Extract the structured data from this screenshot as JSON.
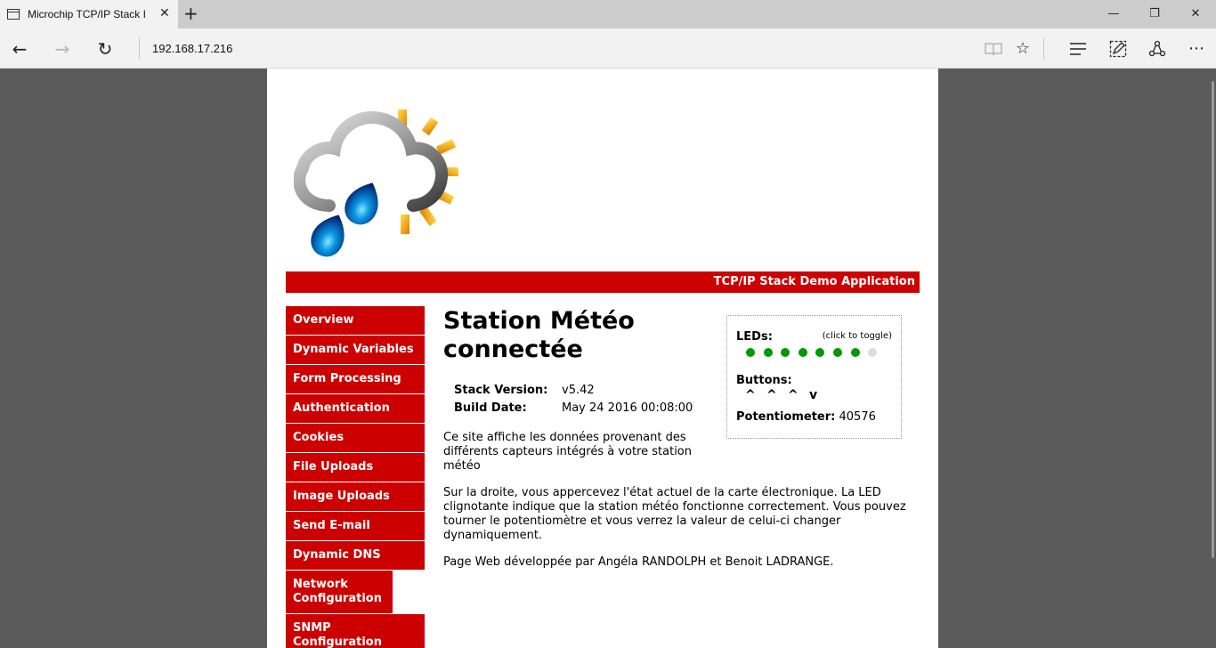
{
  "browser": {
    "tab_title": "Microchip TCP/IP Stack I",
    "tab_close": "✕",
    "new_tab": "+",
    "url": "192.168.17.216",
    "window_controls": {
      "minimize": "—",
      "restore": "❐",
      "close": "✕"
    },
    "nav": {
      "back": "←",
      "forward": "→",
      "refresh": "↻"
    },
    "tools": {
      "reading": "📖",
      "favorite": "☆",
      "hub": "☰",
      "note": "✎",
      "share": "⇪",
      "more": "⋯"
    }
  },
  "page": {
    "banner": "TCP/IP Stack Demo Application",
    "menu": [
      {
        "label": "Overview"
      },
      {
        "label": "Dynamic Variables"
      },
      {
        "label": "Form Processing"
      },
      {
        "label": "Authentication"
      },
      {
        "label": "Cookies"
      },
      {
        "label": "File Uploads"
      },
      {
        "label": "Image Uploads"
      },
      {
        "label": "Send E-mail"
      },
      {
        "label": "Dynamic DNS"
      },
      {
        "label": "Network Configuration"
      },
      {
        "label": "SNMP Configuration"
      }
    ],
    "title": "Station Météo connectée",
    "info": {
      "stack_version_label": "Stack Version:",
      "stack_version": "v5.42",
      "build_date_label": "Build Date:",
      "build_date": "May 24 2016 00:08:00"
    },
    "paragraphs": [
      "Ce site affiche les données provenant des différents capteurs intégrés à votre station météo",
      "Sur la droite, vous appercevez l'état actuel de la carte électronique. La LED clignotante indique que la station météo fonctionne correctement. Vous pouvez tourner le potentiomètre et vous verrez la valeur de celui-ci changer dynamiquement.",
      "Page Web développée par Angéla RANDOLPH et Benoit LADRANGE."
    ],
    "status": {
      "leds_label": "LEDs:",
      "toggle_hint": "(click to toggle)",
      "leds": [
        true,
        true,
        true,
        true,
        true,
        true,
        true,
        false
      ],
      "led_on_color": "#009900",
      "led_off_color": "#dddddd",
      "buttons_label": "Buttons:",
      "buttons": [
        "^",
        "^",
        "^",
        "v"
      ],
      "pot_label": "Potentiometer:",
      "pot_value": "40576"
    }
  }
}
